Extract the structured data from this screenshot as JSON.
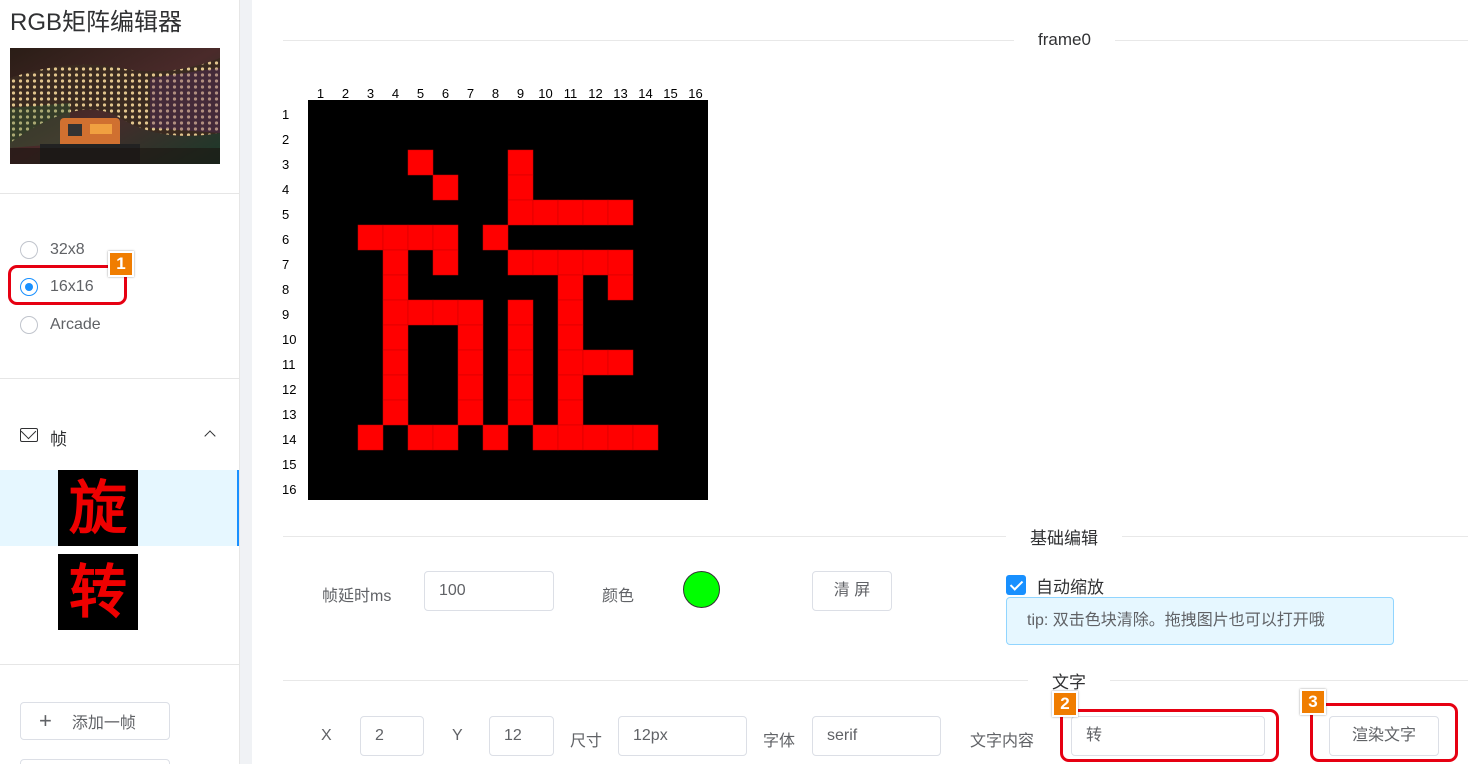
{
  "app": {
    "title": "RGB矩阵编辑器"
  },
  "sidebar": {
    "size_options": [
      {
        "label": "32x8",
        "checked": false
      },
      {
        "label": "16x16",
        "checked": true
      },
      {
        "label": "Arcade",
        "checked": false
      }
    ],
    "frames_menu": {
      "label": "帧",
      "icon": "mail-icon",
      "expand_icon": "chevron-up-icon"
    },
    "frames": [
      {
        "glyph": "旋",
        "active": true
      },
      {
        "glyph": "转",
        "active": false
      }
    ],
    "add_frame": {
      "icon": "plus-icon",
      "label": "添加一帧"
    }
  },
  "main": {
    "frame_title": "frame0",
    "matrix": {
      "columns": [
        "1",
        "2",
        "3",
        "4",
        "5",
        "6",
        "7",
        "8",
        "9",
        "10",
        "11",
        "12",
        "13",
        "14",
        "15",
        "16"
      ],
      "rows": [
        "1",
        "2",
        "3",
        "4",
        "5",
        "6",
        "7",
        "8",
        "9",
        "10",
        "11",
        "12",
        "13",
        "14",
        "15",
        "16"
      ],
      "on_color": "#ff0000",
      "off_color": "#000000",
      "pixel_rows": [
        "................",
        "................",
        "....#...#.......",
        ".....#..#.......",
        "........#####...",
        "..####.#........",
        "...#.#..#####...",
        "...#......#.#...",
        "...####.#.#.....",
        "...#..#.#.#.....",
        "...#..#.#.###...",
        "...#..#.#.#.....",
        "...#..#.#.#.....",
        "..#.##.#.#####..",
        "................",
        "................"
      ]
    },
    "basic_section": {
      "title": "基础编辑",
      "delay_label": "帧延时ms",
      "delay_value": "100",
      "color_label": "颜色",
      "color_value": "#00ff00",
      "clear_button": "清 屏",
      "auto_scale_label": "自动缩放",
      "auto_scale_checked": true,
      "tip": "tip: 双击色块清除。拖拽图片也可以打开哦"
    },
    "text_section": {
      "title": "文字",
      "x_label": "X",
      "x_value": "2",
      "y_label": "Y",
      "y_value": "12",
      "size_label": "尺寸",
      "size_value": "12px",
      "font_label": "字体",
      "font_value": "serif",
      "content_label": "文字内容",
      "content_value": "转",
      "render_button": "渲染文字"
    }
  },
  "annotations": {
    "badge1": "1",
    "badge2": "2",
    "badge3": "3"
  }
}
